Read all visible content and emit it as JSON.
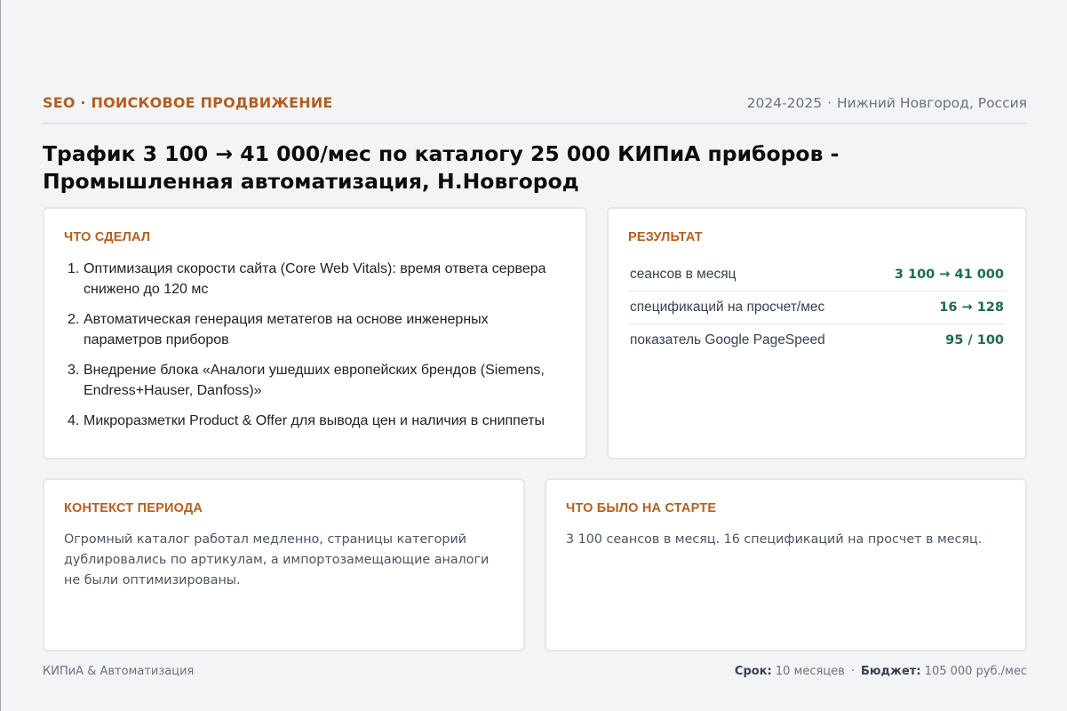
{
  "header": {
    "category": "SEO · ПОИСКОВОЕ ПРОДВИЖЕНИЕ",
    "years": "2024-2025",
    "location": "Нижний Новгород, Россия"
  },
  "title": "Трафик 3 100 → 41 000/мес по каталогу 25 000 КИПиА приборов - Промышленная автоматизация, Н.Новгород",
  "did": {
    "title": "ЧТО СДЕЛАЛ",
    "items": [
      "Оптимизация скорости сайта (Core Web Vitals): время ответа сервера снижено до 120 мс",
      "Автоматическая генерация метатегов на основе инженерных параметров приборов",
      "Внедрение блока «Аналоги ушедших европейских брендов (Siemens, Endress+Hauser, Danfoss)»",
      "Микроразметки Product & Offer для вывода цен и наличия в сниппеты"
    ]
  },
  "result": {
    "title": "РЕЗУЛЬТАТ",
    "metrics": [
      {
        "label": "сеансов в месяц",
        "value": "3 100 → 41 000"
      },
      {
        "label": "спецификаций на просчет/мес",
        "value": "16 → 128"
      },
      {
        "label": "показатель Google PageSpeed",
        "value": "95 / 100"
      }
    ]
  },
  "context": {
    "title": "КОНТЕКСТ ПЕРИОДА",
    "text": "Огромный каталог работал медленно, страницы категорий дублировались по артикулам, а импортозамещающие аналоги не были оптимизированы."
  },
  "start": {
    "title": "ЧТО БЫЛО НА СТАРТЕ",
    "text": "3 100 сеансов в месяц. 16 спецификаций на просчет в месяц."
  },
  "footer": {
    "client": "КИПиА & Автоматизация",
    "term_label": "Срок:",
    "term_value": "10 месяцев",
    "budget_label": "Бюджет:",
    "budget_value": "105 000 руб./мес"
  },
  "colors": {
    "accent": "#b45f1f",
    "metric_value": "#1f6b4a",
    "background": "#f3f4f6"
  }
}
